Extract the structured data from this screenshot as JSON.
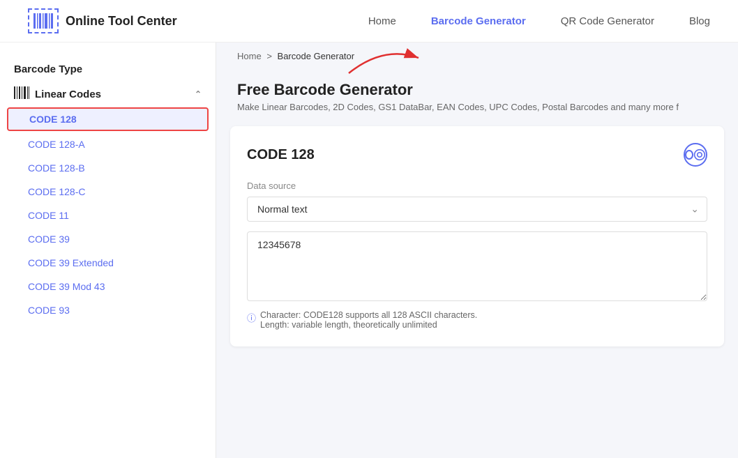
{
  "header": {
    "logo_text": "Online Tool Center",
    "nav": [
      {
        "id": "home",
        "label": "Home",
        "active": false
      },
      {
        "id": "barcode-generator",
        "label": "Barcode Generator",
        "active": true
      },
      {
        "id": "qr-code-generator",
        "label": "QR Code Generator",
        "active": false
      },
      {
        "id": "blog",
        "label": "Blog",
        "active": false
      }
    ]
  },
  "sidebar": {
    "barcode_type_label": "Barcode Type",
    "sections": [
      {
        "id": "linear-codes",
        "label": "Linear Codes",
        "expanded": true,
        "items": [
          {
            "id": "code128",
            "label": "CODE 128",
            "selected": true
          },
          {
            "id": "code128a",
            "label": "CODE 128-A",
            "selected": false
          },
          {
            "id": "code128b",
            "label": "CODE 128-B",
            "selected": false
          },
          {
            "id": "code128c",
            "label": "CODE 128-C",
            "selected": false
          },
          {
            "id": "code11",
            "label": "CODE 11",
            "selected": false
          },
          {
            "id": "code39",
            "label": "CODE 39",
            "selected": false
          },
          {
            "id": "code39ext",
            "label": "CODE 39 Extended",
            "selected": false
          },
          {
            "id": "code39mod43",
            "label": "CODE 39 Mod 43",
            "selected": false
          },
          {
            "id": "code93",
            "label": "CODE 93",
            "selected": false
          }
        ]
      }
    ]
  },
  "breadcrumb": {
    "home": "Home",
    "separator": ">",
    "current": "Barcode Generator"
  },
  "content": {
    "page_title": "Free Barcode Generator",
    "page_subtitle": "Make Linear Barcodes, 2D Codes, GS1 DataBar, EAN Codes, UPC Codes, Postal Barcodes and many more f",
    "card": {
      "title": "CODE 128",
      "data_source_label": "Data source",
      "select_options": [
        {
          "value": "normal",
          "label": "Normal text"
        }
      ],
      "select_value": "Normal text",
      "textarea_value": "12345678",
      "info_line1": "Character: CODE128 supports all 128 ASCII characters.",
      "info_line2": "Length: variable length, theoretically unlimited"
    }
  }
}
